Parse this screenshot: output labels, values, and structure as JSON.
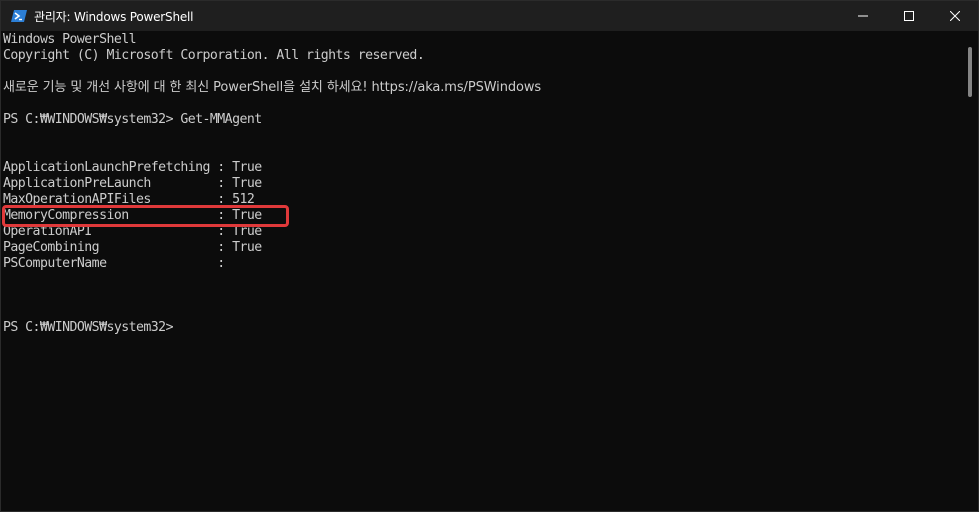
{
  "window": {
    "title": "관리자: Windows PowerShell",
    "app_icon": "powershell-icon",
    "minimize_icon": "minimize-icon",
    "maximize_icon": "maximize-icon",
    "close_icon": "close-icon"
  },
  "console": {
    "banner_line1": "Windows PowerShell",
    "banner_line2": "Copyright (C) Microsoft Corporation. All rights reserved.",
    "update_notice": "새로운 기능 및 개선 사항에 대 한 최신 PowerShell을 설치 하세요! https://aka.ms/PSWindows",
    "prompt_1": "PS C:₩WINDOWS₩system32> Get-MMAgent",
    "output_rows": [
      "ApplicationLaunchPrefetching : True",
      "ApplicationPreLaunch         : True",
      "MaxOperationAPIFiles         : 512",
      "MemoryCompression            : True",
      "OperationAPI                 : True",
      "PageCombining                : True",
      "PSComputerName               :"
    ],
    "prompt_2": "PS C:₩WINDOWS₩system32>"
  },
  "colors": {
    "background": "#0c0c0c",
    "text": "#cccccc",
    "titlebar": "#1f1f1f",
    "highlight": "#e0393a"
  }
}
